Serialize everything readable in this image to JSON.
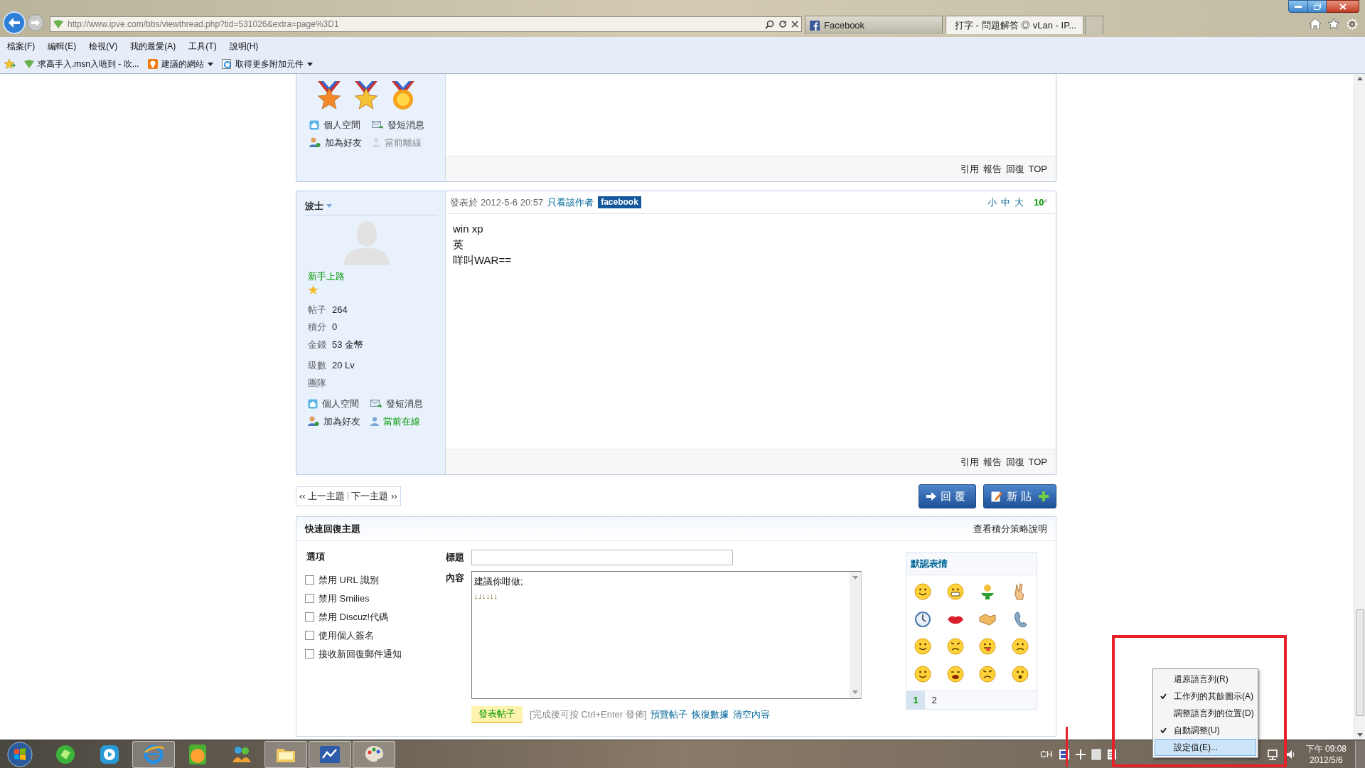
{
  "browser": {
    "address": "http://www.ipve.com/bbs/viewthread.php?tid=531026&extra=page%3D1",
    "tabs": [
      {
        "label": "Facebook",
        "selected": false
      },
      {
        "label": "打字 - 問題解答 ◎ vLan - IP...",
        "selected": true
      }
    ]
  },
  "menu_bar": [
    "檔案(F)",
    "編輯(E)",
    "檢視(V)",
    "我的最愛(A)",
    "工具(T)",
    "說明(H)"
  ],
  "favorites_bar": [
    {
      "label": "求高手入.msn入唔到 - 吹...",
      "dropdown": false
    },
    {
      "label": "建議的網站",
      "dropdown": true
    },
    {
      "label": "取得更多附加元件",
      "dropdown": true
    }
  ],
  "posts": [
    {
      "kind": "continued",
      "profile_links": [
        "個人空間",
        "發短消息",
        "加為好友"
      ],
      "status": {
        "label": "當前離線",
        "online": false
      },
      "actions": [
        "引用",
        "報告",
        "回復",
        "TOP"
      ]
    },
    {
      "kind": "full",
      "author": "波士",
      "rank": "新手上路",
      "stats": [
        [
          {
            "label": "帖子",
            "value": "264"
          },
          {
            "label": "積分",
            "value": "0"
          },
          {
            "label": "金錢",
            "value": "53 金幣"
          }
        ],
        [
          {
            "label": "級數",
            "value": "20 Lv"
          },
          {
            "label": "團隊"
          }
        ]
      ],
      "profile_links": [
        "個人空間",
        "發短消息",
        "加為好友"
      ],
      "status": {
        "label": "當前在線",
        "online": true
      },
      "posted_label": "發表於",
      "date": "2012-5-6 20:57",
      "author_only_link": "只看該作者",
      "share_badge": "facebook",
      "font_sizes": [
        "小",
        "中",
        "大"
      ],
      "floor": "10",
      "floor_mark": "#",
      "body": [
        "win xp",
        "英",
        "咩叫WAR=="
      ],
      "actions": [
        "引用",
        "報告",
        "回復",
        "TOP"
      ]
    }
  ],
  "thread_nav": [
    "‹‹ 上一主題",
    "下一主題 ››"
  ],
  "thread_buttons": [
    "回覆",
    "新貼"
  ],
  "quick_reply": {
    "title": "快速回復主題",
    "policy_link": "查看積分策略說明",
    "options_title": "選項",
    "options": [
      {
        "label": "禁用 URL 識別",
        "checked": false
      },
      {
        "label": "禁用 Smilies",
        "checked": false
      },
      {
        "label": "禁用 Discuz!代碼",
        "checked": false
      },
      {
        "label": "使用個人簽名",
        "checked": false
      },
      {
        "label": "接收新回復郵件通知",
        "checked": false
      }
    ],
    "subject_label": "標題",
    "content_label": "內容",
    "content_lines": [
      "建議你咁做;",
      "↓↓↓↓↓↓"
    ],
    "submit": "發表帖子",
    "hint": "[完成後可按 Ctrl+Enter 發佈]",
    "links": [
      "預覽帖子",
      "恢復數據",
      "清空內容"
    ],
    "smilies": {
      "title": "默認表情",
      "pages": [
        {
          "label": "1",
          "selected": true
        },
        {
          "label": "2",
          "selected": false
        }
      ]
    }
  },
  "context_menu": [
    {
      "label": "還原語言列(R)",
      "checked": false,
      "selected": false
    },
    {
      "label": "工作列的其餘圖示(A)",
      "checked": true,
      "selected": false
    },
    {
      "label": "調整語言列的位置(D)",
      "checked": false,
      "selected": false
    },
    {
      "label": "自動調整(U)",
      "checked": true,
      "selected": false
    },
    {
      "label": "設定值(E)...",
      "checked": false,
      "selected": true
    }
  ],
  "taskbar": {
    "apps": [
      {
        "open": false
      },
      {
        "open": false
      },
      {
        "open": true
      },
      {
        "open": false
      },
      {
        "open": false
      },
      {
        "open": true
      },
      {
        "open": true
      },
      {
        "open": true
      }
    ],
    "input_language": "CH",
    "time": "下午 09:08",
    "date": "2012/5/6"
  }
}
